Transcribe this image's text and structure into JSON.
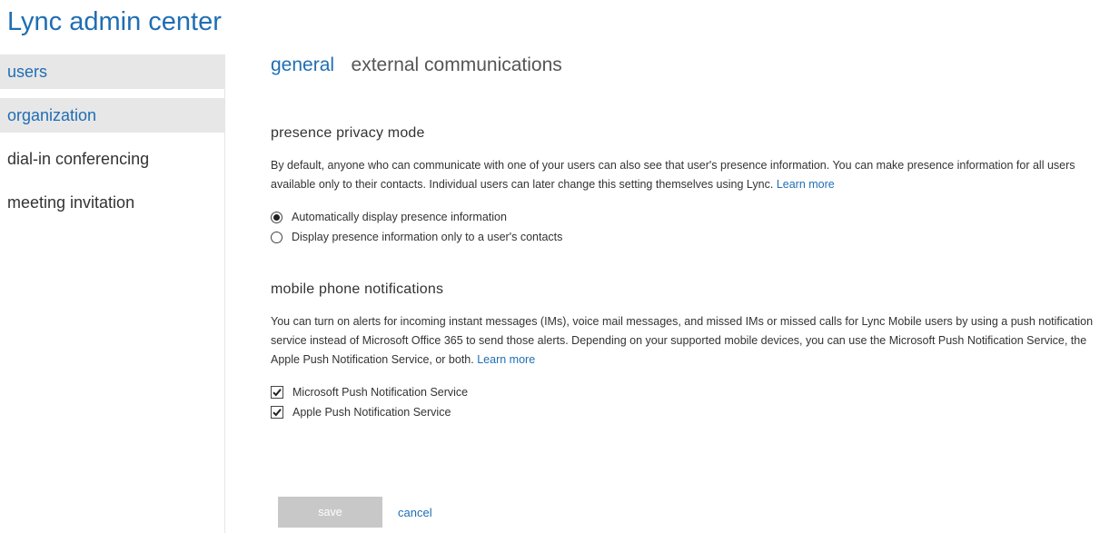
{
  "app": {
    "title": "Lync admin center"
  },
  "sidebar": {
    "items": [
      {
        "label": "users"
      },
      {
        "label": "organization"
      },
      {
        "label": "dial-in conferencing"
      },
      {
        "label": "meeting invitation"
      }
    ]
  },
  "tabs": [
    {
      "label": "general"
    },
    {
      "label": "external communications"
    }
  ],
  "presence": {
    "title": "presence privacy mode",
    "description": "By default, anyone who can communicate with one of your users can also see that user's presence information. You can make presence information for all users available only to their contacts. Individual users can later change this setting themselves using Lync.",
    "learn_more": "Learn more",
    "options": [
      {
        "label": "Automatically display presence information",
        "selected": true
      },
      {
        "label": "Display presence information only to a user's contacts",
        "selected": false
      }
    ]
  },
  "mobile": {
    "title": "mobile phone notifications",
    "description": "You can turn on alerts for incoming instant messages (IMs), voice mail messages, and missed IMs or missed calls for Lync Mobile users by using a push notification service instead of Microsoft Office 365 to send those alerts. Depending on your supported mobile devices, you can use the Microsoft Push Notification Service, the Apple Push Notification Service, or both.",
    "learn_more": "Learn more",
    "options": [
      {
        "label": "Microsoft Push Notification Service",
        "checked": true
      },
      {
        "label": "Apple Push Notification Service",
        "checked": true
      }
    ]
  },
  "actions": {
    "save_label": "save",
    "cancel_label": "cancel"
  }
}
